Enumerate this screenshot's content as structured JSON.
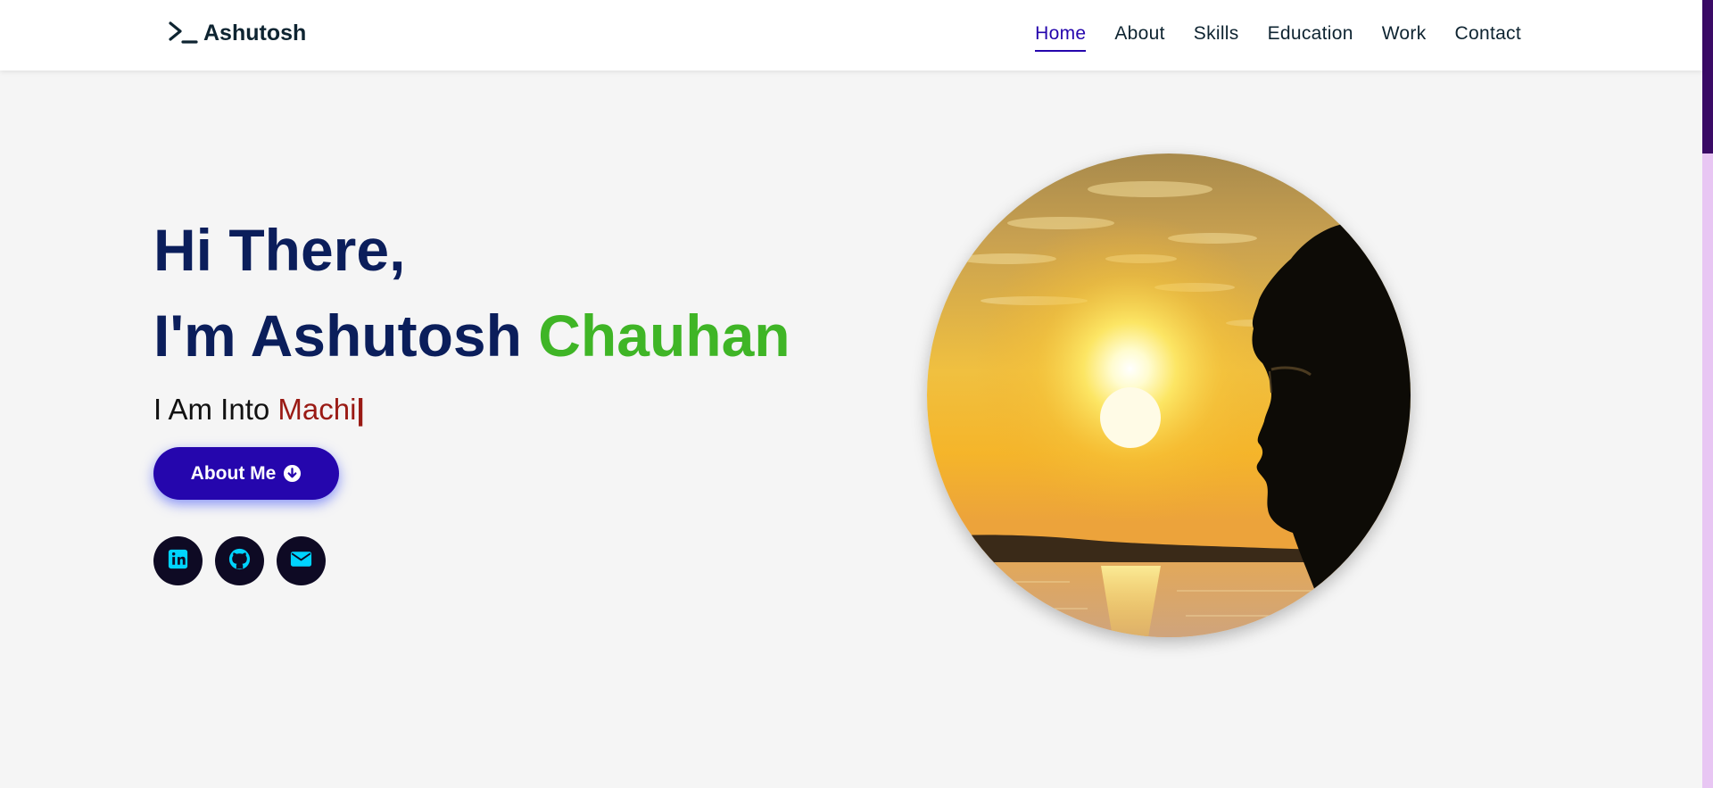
{
  "header": {
    "logo_text": "Ashutosh",
    "nav": [
      {
        "label": "Home",
        "active": true
      },
      {
        "label": "About",
        "active": false
      },
      {
        "label": "Skills",
        "active": false
      },
      {
        "label": "Education",
        "active": false
      },
      {
        "label": "Work",
        "active": false
      },
      {
        "label": "Contact",
        "active": false
      }
    ]
  },
  "hero": {
    "greeting": "Hi There,",
    "name_prefix": "I'm Ashutosh",
    "name_highlight": "Chauhan",
    "typed_prefix": "I Am Into",
    "typed_word": "Machi",
    "caret": "|",
    "button_label": "About Me",
    "button_icon": "arrow-circle-down-icon",
    "socials": [
      {
        "icon": "linkedin-icon"
      },
      {
        "icon": "github-icon"
      },
      {
        "icon": "mail-icon"
      }
    ]
  },
  "colors": {
    "navy": "#0b1e5b",
    "green": "#3fb526",
    "typed_red": "#9a1a14",
    "button_blue": "#2506ad",
    "social_bg": "#0e0a24",
    "social_icon": "#00d4ff",
    "nav_active": "#2506ad",
    "scrollbar_track": "#e8c6f3",
    "scrollbar_thumb": "#3a0a66"
  }
}
